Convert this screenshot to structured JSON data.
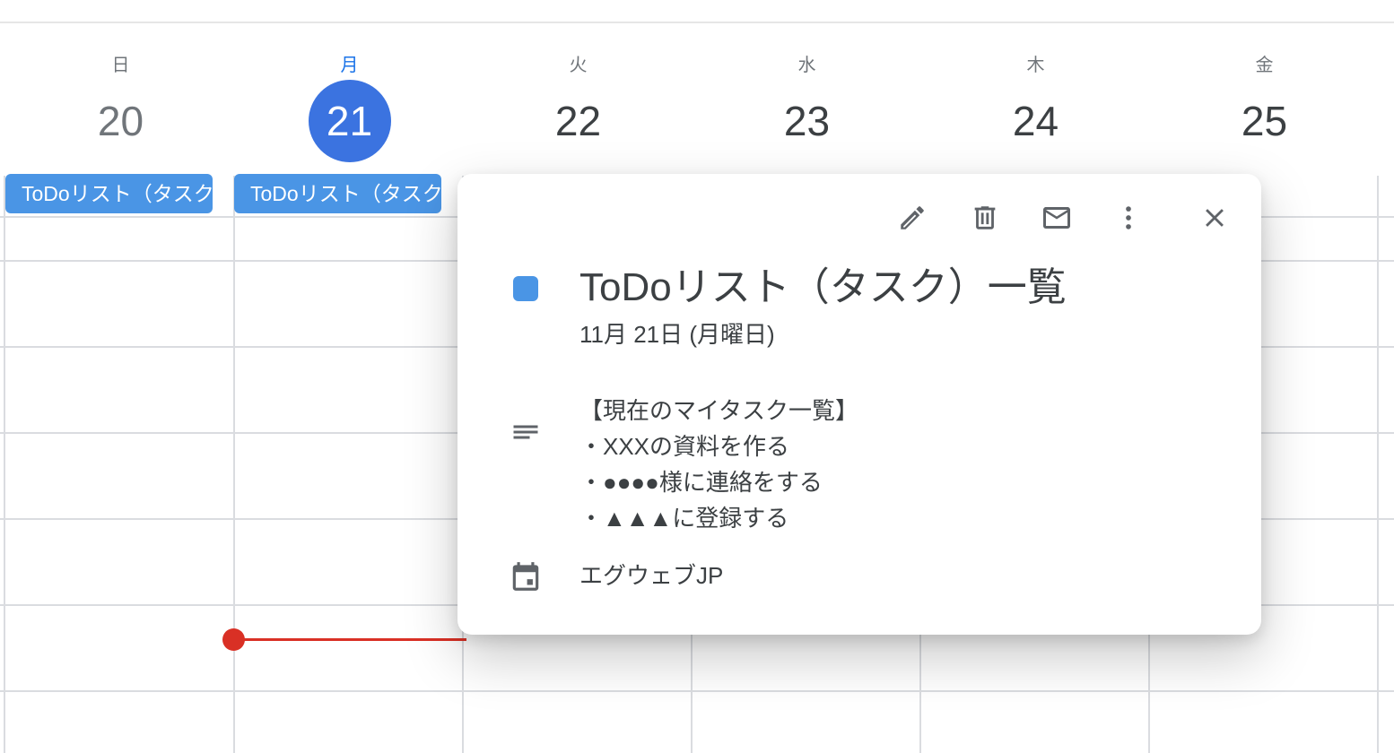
{
  "days": [
    {
      "name": "日",
      "num": "20"
    },
    {
      "name": "月",
      "num": "21"
    },
    {
      "name": "火",
      "num": "22"
    },
    {
      "name": "水",
      "num": "23"
    },
    {
      "name": "木",
      "num": "24"
    },
    {
      "name": "金",
      "num": "25"
    }
  ],
  "all_day_chips": [
    {
      "label": "ToDoリスト（タスク）一覧"
    },
    {
      "label": "ToDoリスト（タスク）一覧"
    }
  ],
  "colors": {
    "today": "#3b73e0",
    "event": "#4a95e5",
    "now_line": "#d93025"
  },
  "popup": {
    "toolbar_icons": [
      "edit-icon",
      "delete-icon",
      "email-icon",
      "more-options-icon",
      "close-icon"
    ],
    "title": "ToDoリスト（タスク）一覧",
    "date": "11月 21日 (月曜日)",
    "description": [
      "【現在のマイタスク一覧】",
      "・XXXの資料を作る",
      "・●●●●様に連絡をする",
      "・▲▲▲に登録する"
    ],
    "calendar_name": "エグウェブJP"
  }
}
